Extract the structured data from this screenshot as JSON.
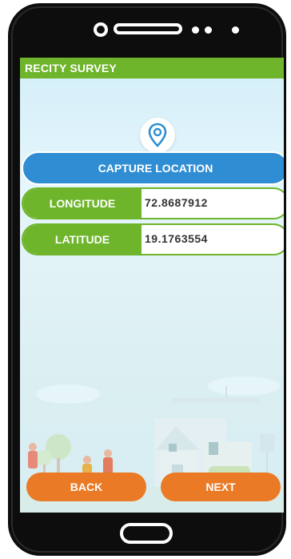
{
  "app": {
    "title": "RECITY SURVEY"
  },
  "location": {
    "capture_label": "CAPTURE LOCATION",
    "icon": "location-pin-icon"
  },
  "fields": {
    "longitude": {
      "label": "LONGITUDE",
      "value": "72.8687912"
    },
    "latitude": {
      "label": "LATITUDE",
      "value": "19.1763554"
    }
  },
  "navigation": {
    "back_label": "BACK",
    "next_label": "NEXT"
  },
  "colors": {
    "app_bar": "#6eb52b",
    "capture_button": "#2f8ed3",
    "field_label": "#6eb52b",
    "nav_button": "#ea7a25",
    "device": "#0d0d0d"
  }
}
